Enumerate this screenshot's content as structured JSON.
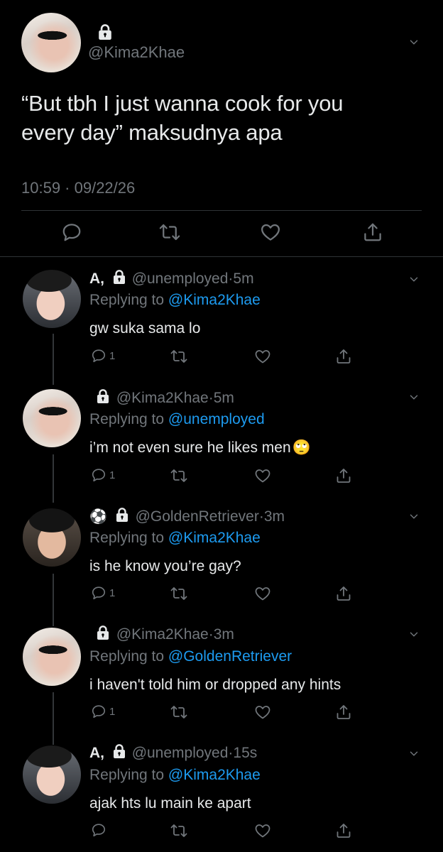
{
  "main_tweet": {
    "handle": "@Kima2Khae",
    "text_line1": "“But tbh I just wanna cook for you",
    "text_line2": "every day” maksudnya apa",
    "timestamp": "10:59 · 09/22/26"
  },
  "replies": [
    {
      "name": "A,",
      "handle": "@unemployed",
      "time": "5m",
      "replying_label": "Replying to",
      "replying_to": "@Kima2Khae",
      "text": "gw suka sama lo",
      "reply_count": "1"
    },
    {
      "name": "",
      "handle": "@Kima2Khae",
      "time": "5m",
      "replying_label": "Replying to",
      "replying_to": "@unemployed",
      "text": "i’m not even sure he likes men",
      "emoji": "🙄",
      "reply_count": "1"
    },
    {
      "name": "⚽",
      "handle": "@GoldenRetriever",
      "time": "3m",
      "replying_label": "Replying to",
      "replying_to": "@Kima2Khae",
      "text": "is he know you’re gay?",
      "reply_count": "1"
    },
    {
      "name": "",
      "handle": "@Kima2Khae",
      "time": "3m",
      "replying_label": "Replying to",
      "replying_to": "@GoldenRetriever",
      "text": "i haven't told him or dropped any hints",
      "reply_count": "1"
    },
    {
      "name": "A,",
      "handle": "@unemployed",
      "time": "15s",
      "replying_label": "Replying to",
      "replying_to": "@Kima2Khae",
      "text": "ajak hts lu main ke apart",
      "reply_count": ""
    }
  ],
  "separator": "·",
  "colors": {
    "background": "#000000",
    "text": "#e7e9ea",
    "muted": "#71767b",
    "link": "#1d9bf0",
    "divider": "#2f3336"
  },
  "icons": [
    "lock-icon",
    "chevron-down-icon",
    "reply-icon",
    "retweet-icon",
    "like-icon",
    "share-icon"
  ]
}
